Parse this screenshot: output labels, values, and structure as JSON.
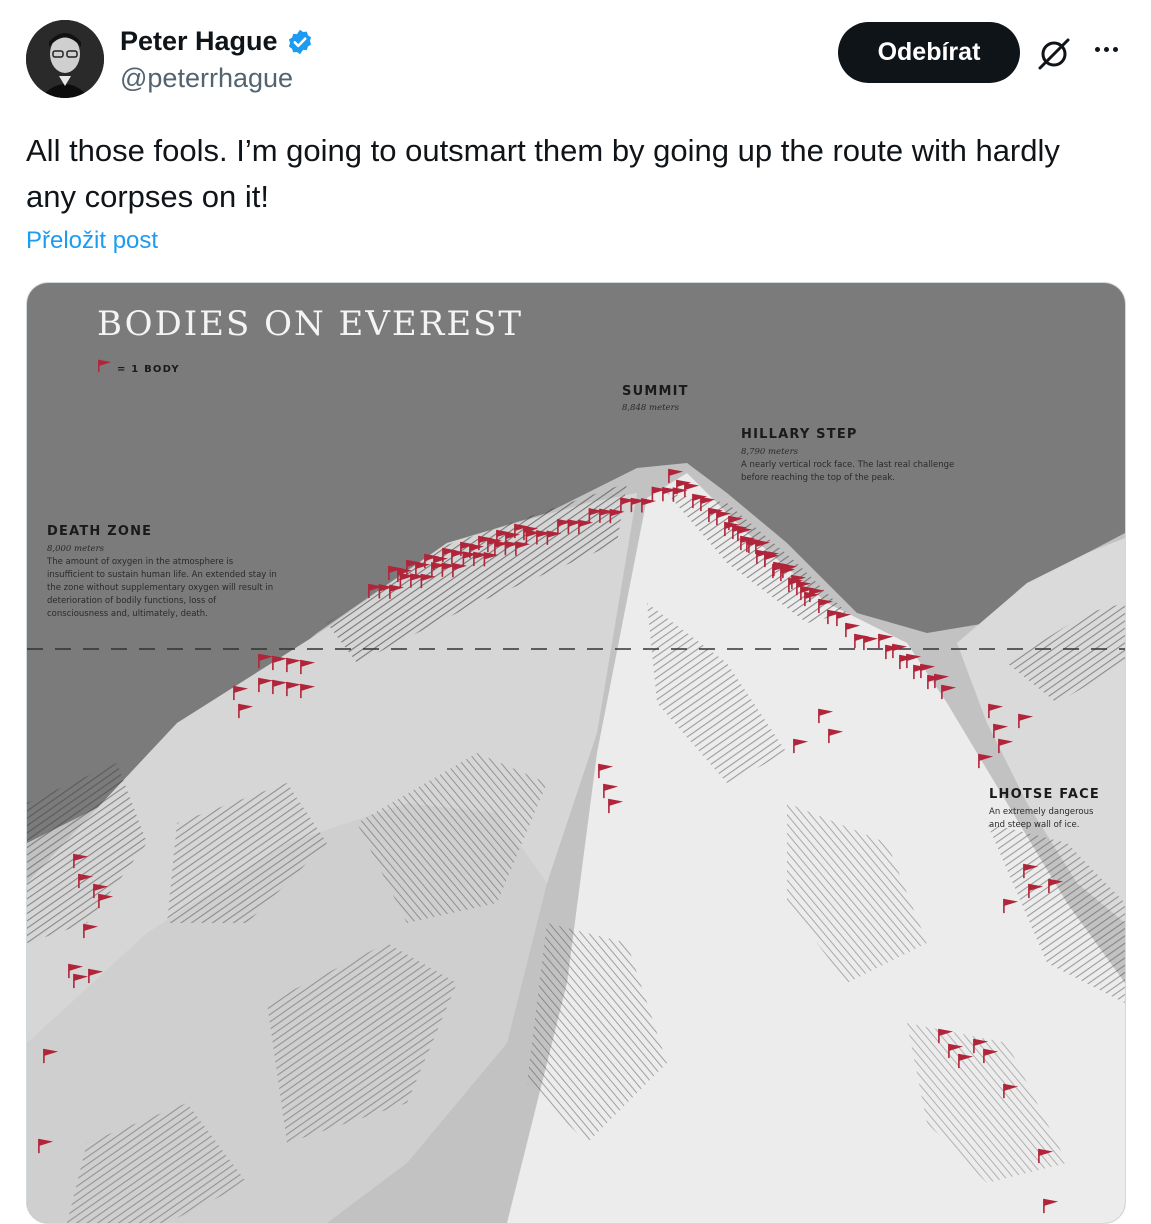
{
  "author": {
    "name": "Peter Hague",
    "handle": "@peterrhague",
    "verified": true,
    "avatar_icon": "person-photo"
  },
  "actions": {
    "subscribe_label": "Odebírat",
    "grok_icon": "slashed-circle-icon",
    "more_icon": "more-horizontal-icon"
  },
  "tweet": {
    "text": "All those fools. I’m going to outsmart them by going up the route with hardly any corpses on it!",
    "translate_label": "Přeložit post"
  },
  "infographic": {
    "title": "BODIES ON EVEREST",
    "legend": "= 1 BODY",
    "summit": {
      "label": "SUMMIT",
      "elevation": "8,848 meters"
    },
    "hillary_step": {
      "label": "HILLARY STEP",
      "elevation": "8,790 meters",
      "desc1": "A nearly vertical rock face. The last real challenge",
      "desc2": "before reaching the top of the peak."
    },
    "death_zone": {
      "label": "DEATH ZONE",
      "elevation": "8,000 meters",
      "desc1": "The amount of oxygen in the atmosphere is",
      "desc2": "insufficient to sustain human life. An extended stay in",
      "desc3": "the zone without supplementary oxygen will result in",
      "desc4": "deterioration of bodily functions, loss of",
      "desc5": "consciousness and, ultimately, death."
    },
    "lhotse_face": {
      "label": "LHOTSE FACE",
      "desc1": "An extremely dangerous",
      "desc2": "and steep wall of ice."
    },
    "colors": {
      "sky": "#7a7a7a",
      "snow": "#e4e4e4",
      "flag": "#b0253a"
    }
  }
}
